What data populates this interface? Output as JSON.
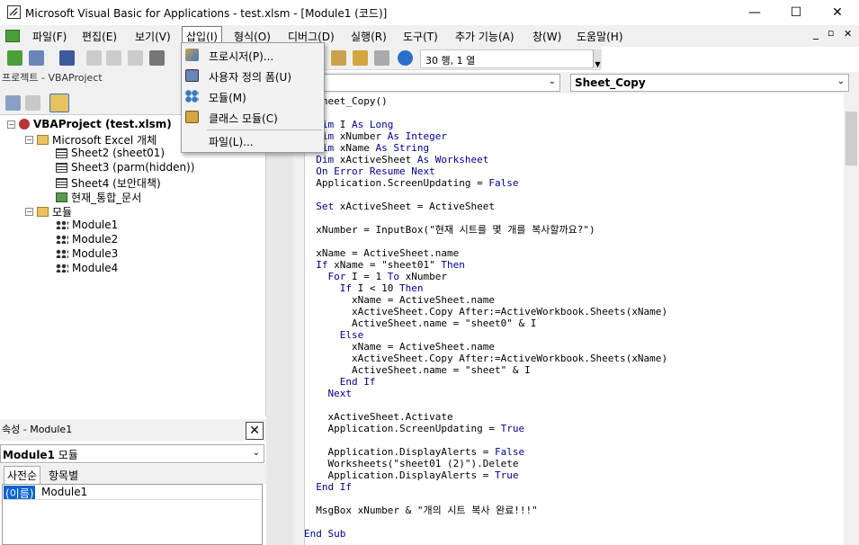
{
  "window": {
    "title": "Microsoft Visual Basic for Applications - test.xlsm - [Module1 (코드)]"
  },
  "menu": {
    "items": [
      "파일(F)",
      "편집(E)",
      "보기(V)",
      "삽입(I)",
      "형식(O)",
      "디버그(D)",
      "실행(R)",
      "도구(T)",
      "추가 기능(A)",
      "창(W)",
      "도움말(H)"
    ],
    "active_index": 3
  },
  "insert_menu": {
    "items": [
      "프로시저(P)...",
      "사용자 정의 폼(U)",
      "모듈(M)",
      "클래스 모듈(C)",
      "파일(L)..."
    ]
  },
  "toolbar": {
    "position": "30 행, 1 열"
  },
  "project": {
    "header": "프로젝트 - VBAProject",
    "tree": [
      {
        "label": "VBAProject (test.xlsm)",
        "level": 0,
        "icon": "project-icon"
      },
      {
        "label": "Microsoft Excel 개체",
        "level": 1,
        "icon": "folder-icon"
      },
      {
        "label": "Sheet2 (sheet01)",
        "level": 2,
        "icon": "sheet-icon"
      },
      {
        "label": "Sheet3 (parm(hidden))",
        "level": 2,
        "icon": "sheet-icon"
      },
      {
        "label": "Sheet4 (보안대책)",
        "level": 2,
        "icon": "sheet-icon"
      },
      {
        "label": "현재_통합_문서",
        "level": 2,
        "icon": "workbook-icon"
      },
      {
        "label": "모듈",
        "level": 1,
        "icon": "folder-icon"
      },
      {
        "label": "Module1",
        "level": 2,
        "icon": "module-icon"
      },
      {
        "label": "Module2",
        "level": 2,
        "icon": "module-icon"
      },
      {
        "label": "Module3",
        "level": 2,
        "icon": "module-icon"
      },
      {
        "label": "Module4",
        "level": 2,
        "icon": "module-icon"
      }
    ]
  },
  "properties": {
    "header": "속성 - Module1",
    "object_name": "Module1",
    "object_type": "모듈",
    "tabs": [
      "사전순",
      "항목별"
    ],
    "row_name": "(이름)",
    "row_value": "Module1"
  },
  "code_window": {
    "procedure": "Sheet_Copy",
    "lines": [
      "  Sheet_Copy()",
      "",
      "  Dim I As Long",
      "  Dim xNumber As Integer",
      "  Dim xName As String",
      "  Dim xActiveSheet As Worksheet",
      "  On Error Resume Next",
      "  Application.ScreenUpdating = False",
      "",
      "  Set xActiveSheet = ActiveSheet",
      "",
      "  xNumber = InputBox(\"현재 시트를 몇 개를 복사할까요?\")",
      "",
      "  xName = ActiveSheet.name",
      "  If xName = \"sheet01\" Then",
      "    For I = 1 To xNumber",
      "      If I < 10 Then",
      "        xName = ActiveSheet.name",
      "        xActiveSheet.Copy After:=ActiveWorkbook.Sheets(xName)",
      "        ActiveSheet.name = \"sheet0\" & I",
      "      Else",
      "        xName = ActiveSheet.name",
      "        xActiveSheet.Copy After:=ActiveWorkbook.Sheets(xName)",
      "        ActiveSheet.name = \"sheet\" & I",
      "      End If",
      "    Next",
      "",
      "    xActiveSheet.Activate",
      "    Application.ScreenUpdating = True",
      "",
      "    Application.DisplayAlerts = False",
      "    Worksheets(\"sheet01 (2)\").Delete",
      "    Application.DisplayAlerts = True",
      "  End If",
      "",
      "  MsgBox xNumber & \"개의 시트 복사 완료!!!\"",
      "",
      "End Sub"
    ]
  }
}
